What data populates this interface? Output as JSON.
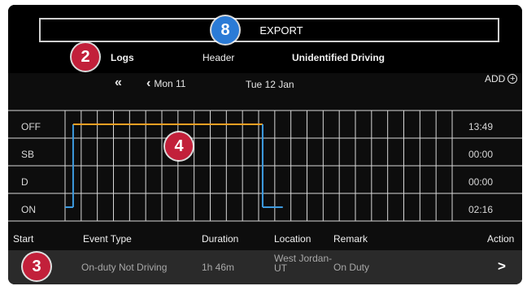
{
  "export": {
    "label": "EXPORT"
  },
  "tabs": [
    {
      "label": "Logs"
    },
    {
      "label": "Header"
    },
    {
      "label": "Unidentified Driving"
    }
  ],
  "badges": {
    "export": "8",
    "logs": "2",
    "chart": "4",
    "row": "3"
  },
  "date_nav": {
    "first_icon": "double-chevron-left-icon",
    "prev_icon": "chevron-left-icon",
    "prev_label": "Mon 11",
    "current_label": "Tue 12 Jan",
    "add_label": "ADD",
    "add_icon": "plus-circle-icon"
  },
  "chart_data": {
    "type": "line",
    "rows": [
      "OFF",
      "SB",
      "D",
      "ON"
    ],
    "totals": [
      "13:49",
      "00:00",
      "00:00",
      "02:16"
    ],
    "segments": [
      {
        "status": "ON",
        "from": 0,
        "to": 0.5
      },
      {
        "status": "OFF",
        "from": 0.5,
        "to": 12.25
      },
      {
        "status": "ON",
        "from": 12.25,
        "to": 13.5
      }
    ],
    "colors": {
      "OFF": "#f5a023",
      "ON": "#3d9be0",
      "grid": "#d9d9d9"
    },
    "hours": 24
  },
  "table": {
    "headers": [
      "Start",
      "Event Type",
      "Duration",
      "Location",
      "Remark",
      "Action"
    ],
    "rows": [
      {
        "event_type": "On-duty Not Driving",
        "duration": "1h 46m",
        "location_line1": "West Jordan-",
        "location_line2": "UT",
        "remark": "On Duty",
        "action_icon": "chevron-right-icon"
      }
    ]
  }
}
